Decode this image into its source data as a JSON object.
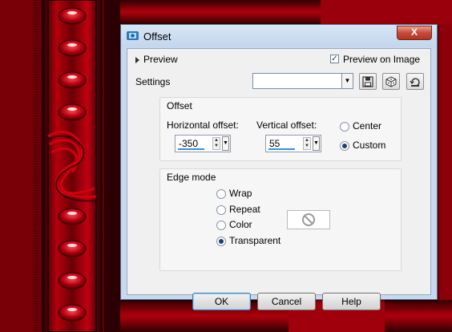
{
  "dialog": {
    "title": "Offset",
    "close_label": "X",
    "preview_label": "Preview",
    "preview_on_image_label": "Preview on Image",
    "preview_on_image_checked": true,
    "settings_label": "Settings",
    "settings_value": ""
  },
  "offset_group": {
    "title": "Offset",
    "horizontal_label": "Horizontal offset:",
    "horizontal_value": "-350",
    "vertical_label": "Vertical offset:",
    "vertical_value": "55",
    "anchor_options": [
      {
        "label": "Center",
        "selected": false
      },
      {
        "label": "Custom",
        "selected": true
      }
    ]
  },
  "edge_group": {
    "title": "Edge mode",
    "options": [
      {
        "label": "Wrap",
        "selected": false
      },
      {
        "label": "Repeat",
        "selected": false
      },
      {
        "label": "Color",
        "selected": false
      },
      {
        "label": "Transparent",
        "selected": true
      }
    ]
  },
  "buttons": {
    "ok": "OK",
    "cancel": "Cancel",
    "help": "Help"
  },
  "icons": [
    "app-icon",
    "save-preset-icon",
    "randomize-icon",
    "reset-icon",
    "no-color-icon"
  ],
  "colors": {
    "background_red": "#8a0008",
    "dialog_frame": "#c7d9ee",
    "accent_blue": "#3c8de0"
  }
}
